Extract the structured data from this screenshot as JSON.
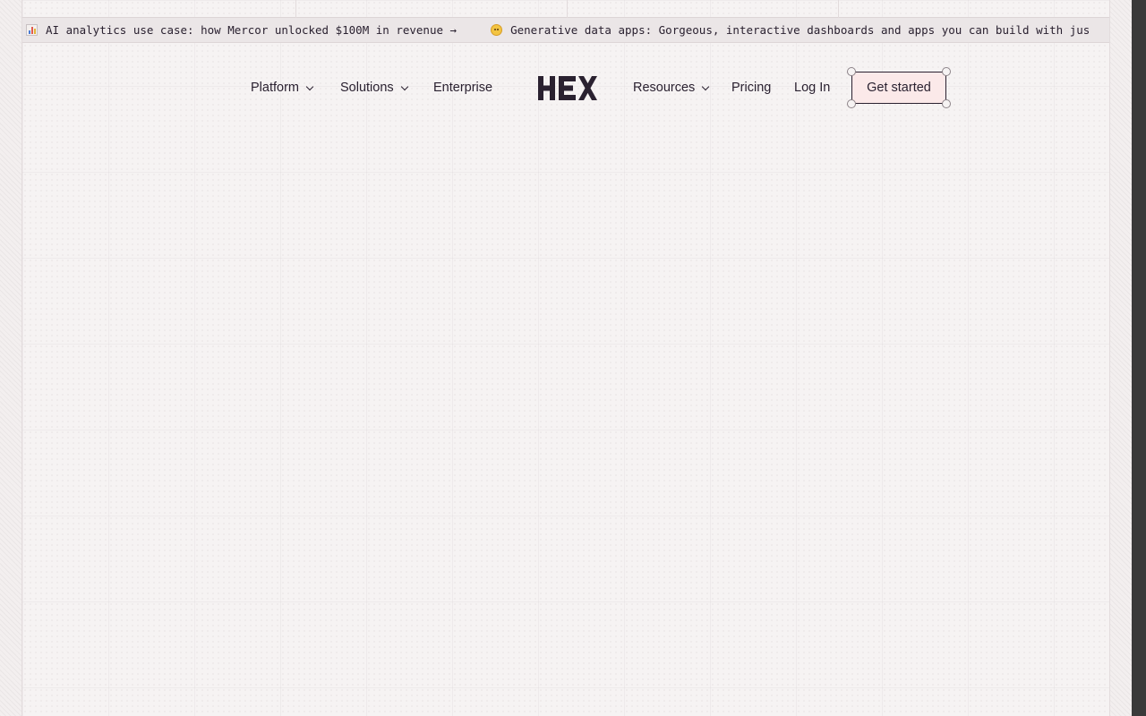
{
  "announcement": {
    "items": [
      {
        "icon": "bar-chart-emoji-icon",
        "text": "AI analytics use case: how Mercor unlocked $100M in revenue →"
      },
      {
        "icon": "exploding-head-emoji-icon",
        "text": "Generative data apps: Gorgeous, interactive dashboards and apps you can build with jus"
      }
    ]
  },
  "nav": {
    "platform": "Platform",
    "solutions": "Solutions",
    "enterprise": "Enterprise",
    "resources": "Resources",
    "pricing": "Pricing",
    "login": "Log In",
    "cta": "Get started"
  },
  "logo": {
    "text": "HEX",
    "color": "#2a2130"
  },
  "colors": {
    "page_background": "#f6f3f3",
    "cta_background": "#fbe9e9",
    "text": "#2a2130",
    "announcement_background": "#ebe6e7"
  }
}
